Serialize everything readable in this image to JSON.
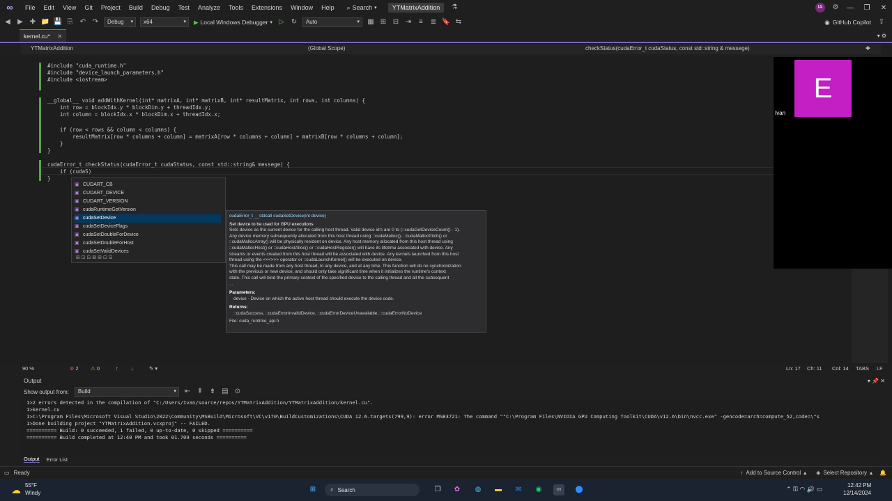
{
  "menu": {
    "items": [
      "File",
      "Edit",
      "View",
      "Git",
      "Project",
      "Build",
      "Debug",
      "Test",
      "Analyze",
      "Tools",
      "Extensions",
      "Window",
      "Help"
    ],
    "search_label": "Search",
    "solution_name": "YTMatrixAddition",
    "user_initials": "IA"
  },
  "toolbar": {
    "config": "Debug",
    "platform": "x64",
    "run_label": "Local Windows Debugger",
    "run_mode": "Auto",
    "copilot_label": "GitHub Copilot"
  },
  "tabs": [
    {
      "label": "kernel.cu*",
      "active": true
    }
  ],
  "navbar": {
    "project": "YTMatrixAddition",
    "scope": "(Global Scope)",
    "member": "checkStatus(cudaError_t cudaStatus, const std::string & messege)"
  },
  "code": [
    "#include \"cuda_runtime.h\"",
    "#include \"device_launch_parameters.h\"",
    "#include <iostream>",
    "",
    "",
    "__global__ void addWithKernel(int* matrixA, int* matrixB, int* resultMatrix, int rows, int columns) {",
    "    int row = blockIdx.y * blockDim.y + threadIdx.y;",
    "    int column = blockIdx.x * blockDim.x + threadIdx.x;",
    "",
    "    if (row < rows && column < columns) {",
    "        resultMatrix[row * columns + column] = matrixA[row * columns + column] + matrixB[row * columns + column];",
    "    }",
    "}",
    "",
    "cudaError_t checkStatus(cudaError_t cudaStatus, const std::string& messege) {",
    "    if (cudaS)",
    "}"
  ],
  "completion": {
    "items": [
      "CUDART_CB",
      "CUDART_DEVICE",
      "CUDART_VERSION",
      "cudaRuntimeGetVersion",
      "cudaSetDevice",
      "cudaSetDeviceFlags",
      "cudaSetDoubleForDevice",
      "cudaSetDoubleForHost",
      "cudaSetValidDevices"
    ],
    "selected_index": 4,
    "filter_icons": "⊞ ⊡ ⊟ ⊠ ⊞ ⊡ ⊟"
  },
  "tooltip": {
    "signature": "cudaError_t __stdcall cudaSetDevice(int device)",
    "lines": [
      "Set device to be used for GPU executions",
      "Sets device as the current device for the calling host thread. Valid device id's are 0 to (::cudaGetDeviceCount() - 1).",
      "Any device memory subsequently allocated from this host thread using ::cudaMalloc(), ::cudaMallocPitch() or",
      "::cudaMallocArray() will be physically resident on device. Any host memory allocated from this host thread using",
      "::cudaMallocHost() or ::cudaHostAlloc() or ::cudaHostRegister() will have its lifetime associated with device. Any",
      "streams or events created from this host thread will be associated with device. Any kernels launched from this host",
      "thread using the <<<>>> operator or ::cudaLaunchKernel() will be executed on device.",
      "This call may be made from any host thread, to any device, and at any time. This function will do no synchronization",
      "with the previous or new device, and should only take significant time when it initializes the runtime's context",
      "state. This call will bind the primary context of the specified device to the calling thread and all the subsequent",
      "..."
    ],
    "params_header": "Parameters:",
    "params": "device - Device on which the active host thread should execute the device code.",
    "returns_header": "Returns:",
    "returns": "::cudaSuccess, ::cudaErrorInvalidDevice, ::cudaErrorDeviceUnavailable, ::cudaErrorNoDevice",
    "file": "File: cuda_runtime_api.h"
  },
  "webcam": {
    "initial": "E",
    "name": "Ivan"
  },
  "editor_status": {
    "zoom": "90 %",
    "errors": "2",
    "warnings": "0",
    "line": "Ln: 17",
    "char": "Ch: 11",
    "col": "Col: 14",
    "indent": "TABS",
    "eol": "LF"
  },
  "output": {
    "title": "Output",
    "show_from_label": "Show output from:",
    "source": "Build",
    "lines": [
      "1>2 errors detected in the compilation of \"C:/Users/Ivan/source/repos/YTMatrixAddition/YTMatrixAddition/kernel.cu\".",
      "1>kernel.cu",
      "1>C:\\Program Files\\Microsoft Visual Studio\\2022\\Community\\MSBuild\\Microsoft\\VC\\v170\\BuildCustomizations\\CUDA 12.6.targets(799,9): error MSB3721: The command \"\"C:\\Program Files\\NVIDIA GPU Computing Toolkit\\CUDA\\v12.6\\bin\\nvcc.exe\" -gencode=arch=compute_52,code=\\\"s",
      "1>Done building project \"YTMatrixAddition.vcxproj\" -- FAILED.",
      "========== Build: 0 succeeded, 1 failed, 0 up-to-date, 0 skipped ==========",
      "========== Build completed at 12:40 PM and took 01.709 seconds =========="
    ],
    "tabs": [
      "Output",
      "Error List"
    ]
  },
  "status": {
    "ready": "Ready",
    "source_control": "Add to Source Control",
    "repo": "Select Repository"
  },
  "taskbar": {
    "weather_temp": "55°F",
    "weather_desc": "Windy",
    "search": "Search",
    "time": "12:42 PM",
    "date": "12/14/2024"
  }
}
